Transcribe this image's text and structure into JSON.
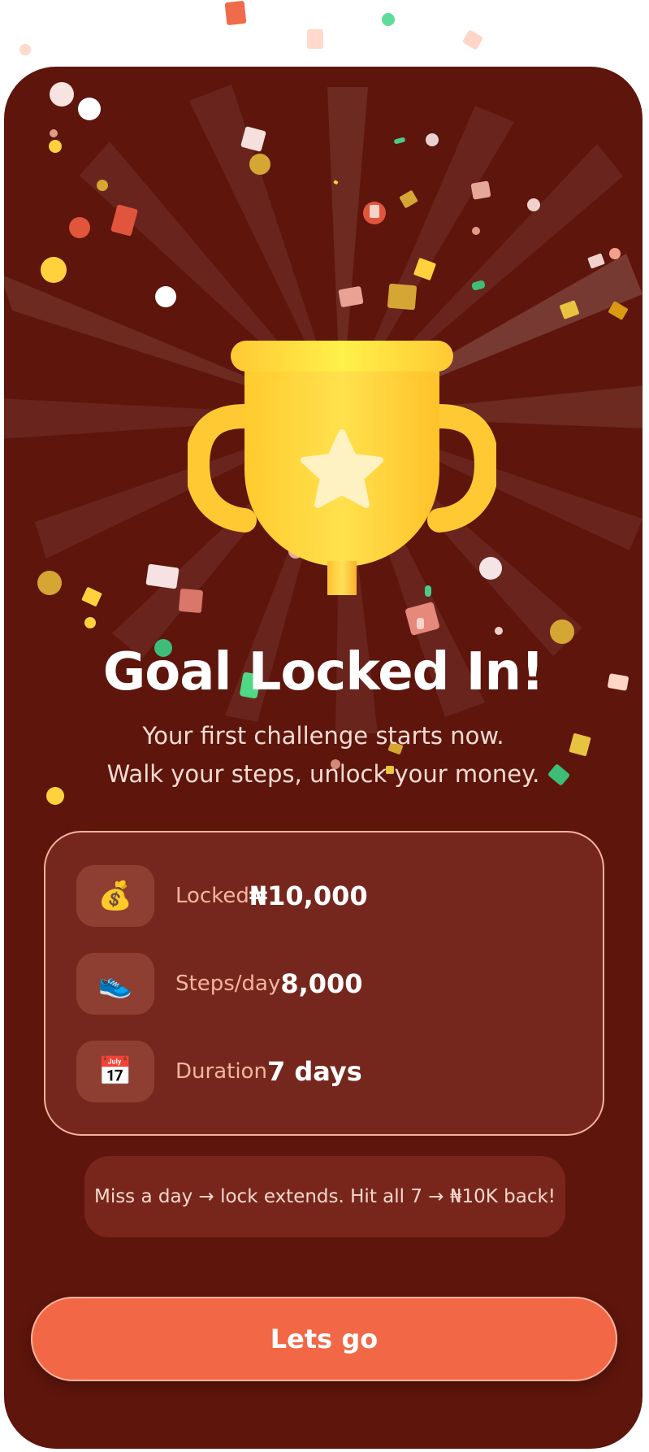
{
  "hero": {
    "title": "Goal Locked In!",
    "subtitle_line1": "Your first challenge starts now.",
    "subtitle_line2": "Walk your steps, unlock your money."
  },
  "summary": {
    "items": [
      {
        "icon": "money-bag-icon",
        "glyph": "💰",
        "label": "Locked",
        "value": "₦10,000"
      },
      {
        "icon": "sneaker-icon",
        "glyph": "👟",
        "label": "Steps/day",
        "value": "8,000"
      },
      {
        "icon": "calendar-icon",
        "glyph": "📅",
        "label": "Duration",
        "value": "7 days"
      }
    ]
  },
  "note": {
    "text": "Miss a day → lock extends. Hit all 7 → ₦10K back!"
  },
  "cta": {
    "label": "Lets go"
  },
  "colors": {
    "background": "#5e150c",
    "card": "#76271d",
    "accent": "#f26746",
    "trophy": "#ffd23d"
  }
}
